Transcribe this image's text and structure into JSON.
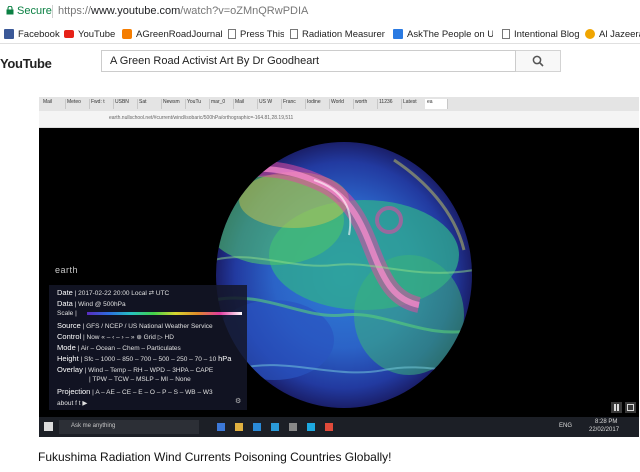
{
  "address_bar": {
    "secure_label": "Secure",
    "url_scheme": "https://",
    "url_host": "www.youtube.com",
    "url_path": "/watch?v=oZMnQRwPDIA"
  },
  "bookmarks": [
    {
      "label": "Facebook",
      "icon": "facebook-icon",
      "color": "#3b5998"
    },
    {
      "label": "YouTube",
      "icon": "youtube-icon",
      "color": "#e62117"
    },
    {
      "label": "AGreenRoadJournal -",
      "icon": "blogger-icon",
      "color": "#f57d00"
    },
    {
      "label": "Press This",
      "icon": "page-icon",
      "color": "#777777"
    },
    {
      "label": "Radiation Measureme",
      "icon": "page-icon",
      "color": "#777777"
    },
    {
      "label": "AskThe People on US",
      "icon": "u-icon",
      "color": "#2a7ae2"
    },
    {
      "label": "Intentional Blog",
      "icon": "page-icon",
      "color": "#777777"
    },
    {
      "label": "Al Jazeera",
      "icon": "aljazeera-icon",
      "color": "#f0a500"
    }
  ],
  "youtube": {
    "logo_text": "YouTube",
    "search_value": "A Green Road Activist Art By Dr Goodheart"
  },
  "video": {
    "inner_tabs": [
      "Mail",
      "Meteo",
      "Fwd: t",
      "USBN",
      "Sat",
      "Newsm",
      "YouTu",
      "mar_0",
      "Mail",
      "US W",
      "Franc",
      "Iodine",
      "World",
      "worth",
      "11236",
      "Latest",
      "ea"
    ],
    "inner_url": "earth.nullschool.net/#current/wind/isobaric/500hPa/orthographic=-164.81,28.19,511",
    "overlay": {
      "earth_label": "earth",
      "date_label": "Date",
      "date_value": "2017-02-22 20:00 Local",
      "date_toggle": "UTC",
      "data_label": "Data",
      "data_value": "Wind @ 500hPa",
      "scale_label": "Scale",
      "source_label": "Source",
      "source_value": "GFS / NCEP / US National Weather Service",
      "control_label": "Control",
      "control_value": "Now   «  –  ‹  –  ›  –  »   ⊕   Grid   ▷   HD",
      "mode_label": "Mode",
      "mode_value": "Air – Ocean – Chem – Particulates",
      "height_label": "Height",
      "height_value": "Sfc – 1000 – 850 – 700 – 500 – 250 – 70 – 10",
      "height_unit": "hPa",
      "overlay_label": "Overlay",
      "overlay_value": "Wind – Temp – RH – WPD – 3HPA – CAPE",
      "overlay_value2": "TPW – TCW – MSLP – MI – None",
      "projection_label": "Projection",
      "projection_value": "A – AE – CE – E – O – P – S – WB – W3",
      "about_label": "about"
    },
    "taskbar": {
      "search_placeholder": "Ask me anything",
      "language": "ENG",
      "time": "8:28 PM",
      "date": "22/02/2017"
    }
  },
  "caption": "Fukushima Radiation Wind Currents Poisoning Countries Globally!"
}
